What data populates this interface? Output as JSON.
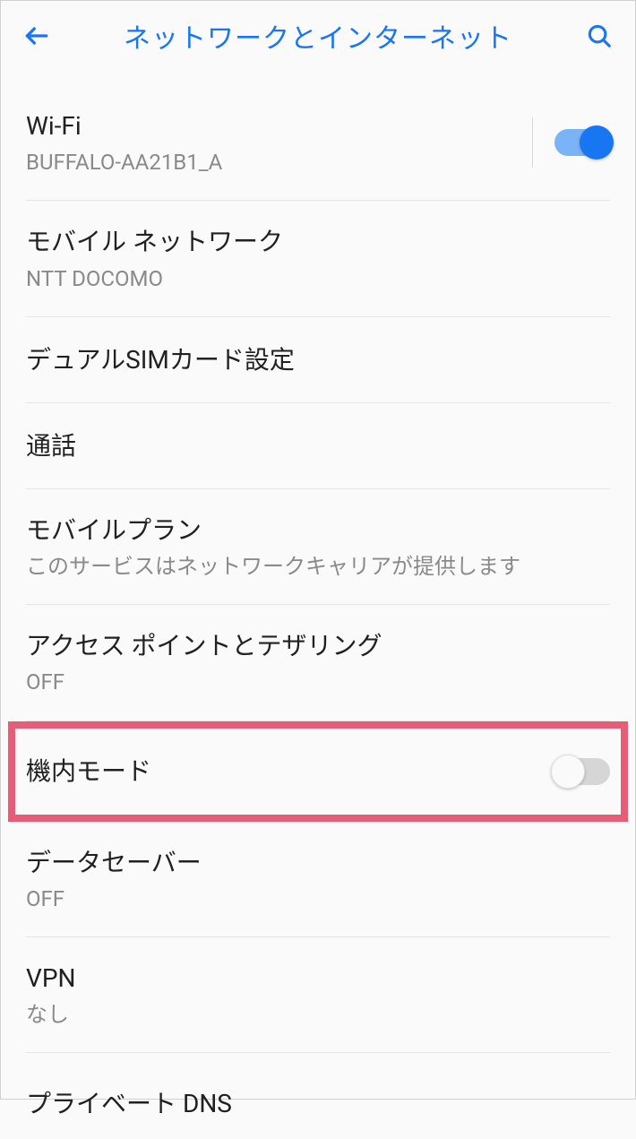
{
  "header": {
    "title": "ネットワークとインターネット"
  },
  "items": {
    "wifi": {
      "title": "Wi-Fi",
      "subtitle": "BUFFALO-AA21B1_A",
      "toggle": "on"
    },
    "mobile_network": {
      "title": "モバイル ネットワーク",
      "subtitle": "NTT DOCOMO"
    },
    "dual_sim": {
      "title": "デュアルSIMカード設定"
    },
    "call": {
      "title": "通話"
    },
    "mobile_plan": {
      "title": "モバイルプラン",
      "subtitle": "このサービスはネットワークキャリアが提供します"
    },
    "hotspot": {
      "title": "アクセス ポイントとテザリング",
      "subtitle": "OFF"
    },
    "airplane": {
      "title": "機内モード",
      "toggle": "off"
    },
    "data_saver": {
      "title": "データセーバー",
      "subtitle": "OFF"
    },
    "vpn": {
      "title": "VPN",
      "subtitle": "なし"
    },
    "private_dns": {
      "title": "プライベート DNS"
    }
  },
  "colors": {
    "accent": "#1976f2",
    "highlight": "#e65d78"
  }
}
